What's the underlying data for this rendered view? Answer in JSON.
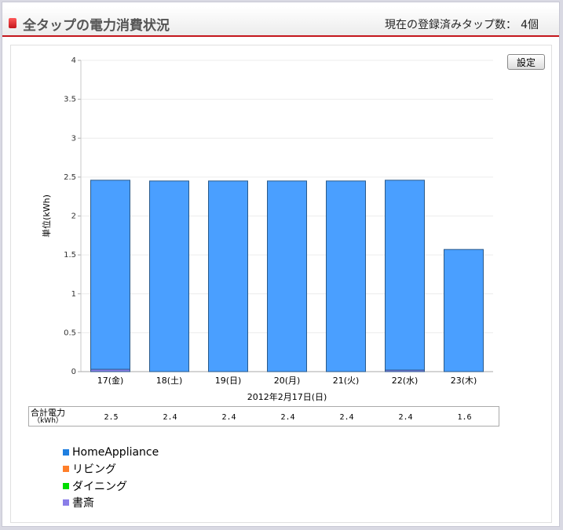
{
  "header": {
    "title": "全タップの電力消費状況",
    "tap_count_label": "現在の登録済みタップ数：",
    "tap_count": "4個"
  },
  "settings_label": "設定",
  "chart_data": {
    "type": "bar",
    "stacked": true,
    "ylabel": "単位(kWh)",
    "xlabel": "2012年2月17日(日)",
    "ylim": [
      0,
      4
    ],
    "yticks": [
      "0",
      "0.5",
      "1",
      "1.5",
      "2",
      "2.5",
      "3",
      "3.5",
      "4"
    ],
    "categories": [
      "17(金)",
      "18(土)",
      "19(日)",
      "20(月)",
      "21(火)",
      "22(水)",
      "23(木)"
    ],
    "grid": true,
    "series": [
      {
        "name": "HomeAppliance",
        "color": "#4a9fff",
        "values": [
          2.43,
          2.45,
          2.45,
          2.45,
          2.45,
          2.44,
          1.57
        ]
      },
      {
        "name": "リビング",
        "color": "#ff7f2a",
        "values": [
          0,
          0,
          0,
          0,
          0,
          0,
          0
        ]
      },
      {
        "name": "ダイニング",
        "color": "#00dd00",
        "values": [
          0,
          0,
          0,
          0,
          0,
          0,
          0
        ]
      },
      {
        "name": "書斎",
        "color": "#8a7ee8",
        "values": [
          0.03,
          0,
          0,
          0,
          0,
          0.02,
          0
        ]
      }
    ]
  },
  "totals": {
    "label": "合計電力",
    "unit": "（kWh）",
    "values": [
      "2.5",
      "2.4",
      "2.4",
      "2.4",
      "2.4",
      "2.4",
      "1.6"
    ]
  },
  "legend": [
    {
      "label": "HomeAppliance",
      "color": "#1f7fe0"
    },
    {
      "label": "リビング",
      "color": "#ff7f2a"
    },
    {
      "label": "ダイニング",
      "color": "#00dd00"
    },
    {
      "label": "書斎",
      "color": "#8a7ee8"
    }
  ]
}
